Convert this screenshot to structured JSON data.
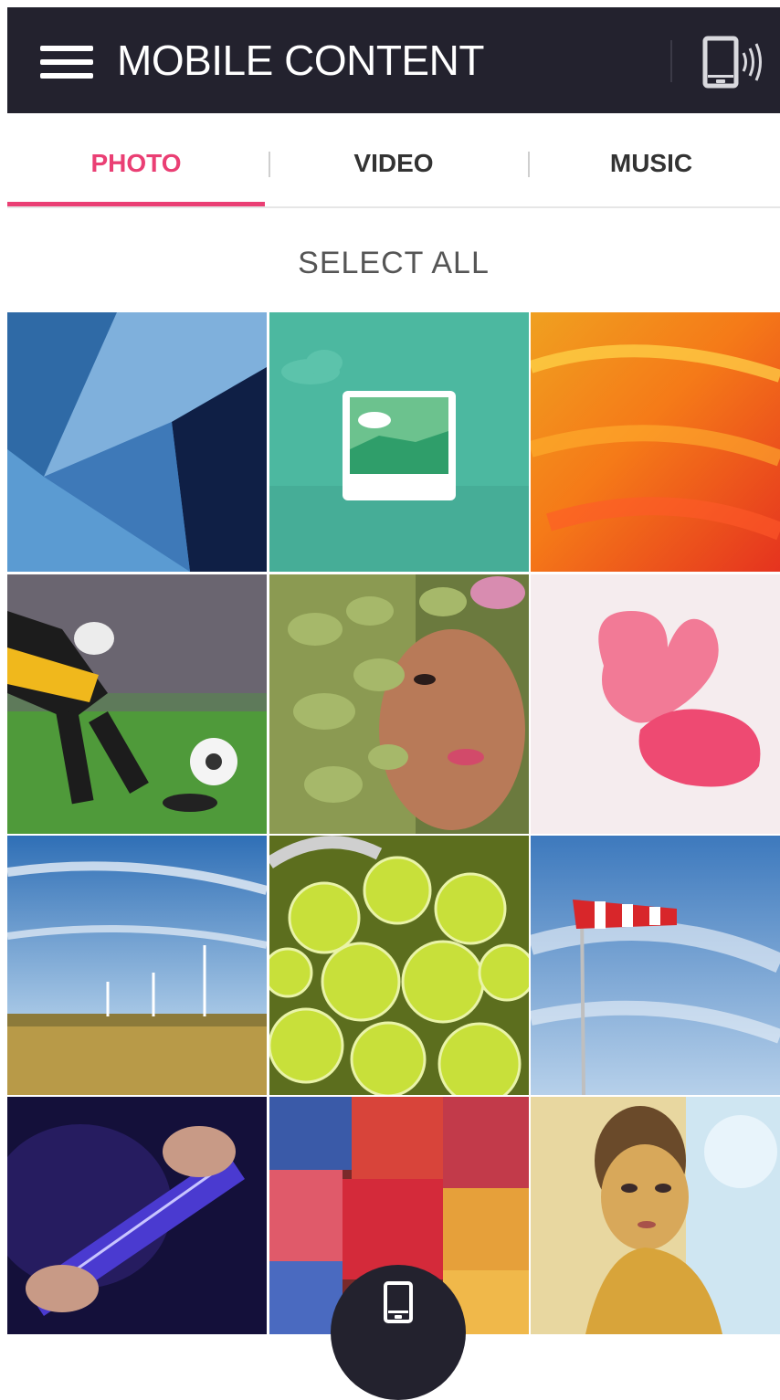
{
  "header": {
    "title": "MOBILE CONTENT",
    "menu_icon": "hamburger-menu-icon",
    "device_icon": "phone-connect-icon",
    "background": "#23222e"
  },
  "tabs": [
    {
      "label": "PHOTO",
      "active": true
    },
    {
      "label": "VIDEO",
      "active": false
    },
    {
      "label": "MUSIC",
      "active": false
    }
  ],
  "accent_color": "#ea3f74",
  "select_all_label": "SELECT ALL",
  "photos": [
    {
      "subject": "blue abstract geometry",
      "selected": false
    },
    {
      "subject": "image placeholder icon",
      "selected": false
    },
    {
      "subject": "orange paint texture",
      "selected": false
    },
    {
      "subject": "soccer goalkeeper kicking ball",
      "selected": false
    },
    {
      "subject": "woman face with leaves",
      "selected": false
    },
    {
      "subject": "pink heart candy",
      "selected": false
    },
    {
      "subject": "wind turbines in wheat field",
      "selected": false
    },
    {
      "subject": "tennis balls in basket",
      "selected": false
    },
    {
      "subject": "windsock against sky",
      "selected": false
    },
    {
      "subject": "guitarist playing electric guitar",
      "selected": false
    },
    {
      "subject": "colorful embroidered fabrics",
      "selected": false
    },
    {
      "subject": "woman with yellow skin makeup",
      "selected": false
    }
  ],
  "fab": {
    "icon": "phone-icon"
  }
}
